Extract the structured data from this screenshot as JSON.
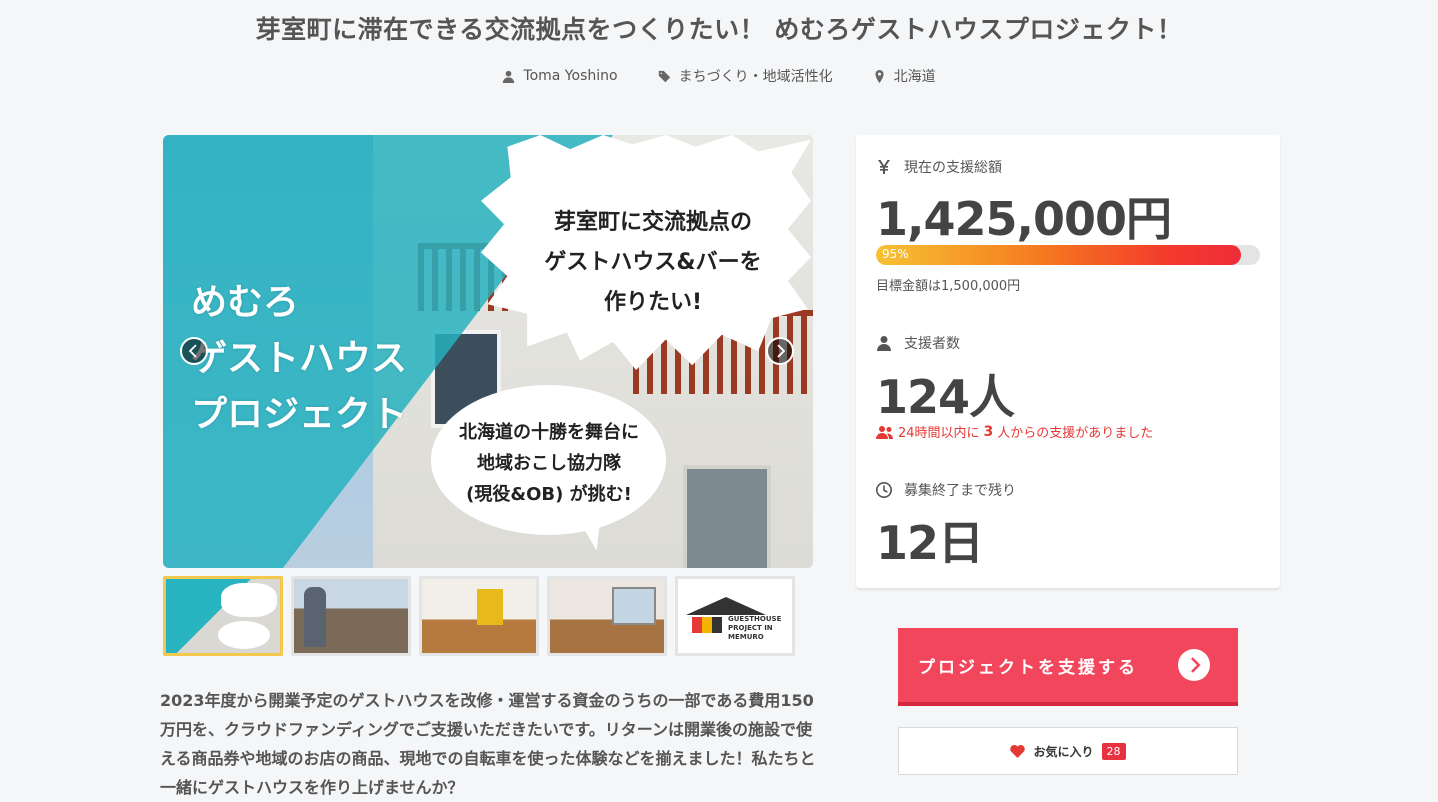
{
  "project": {
    "title": "芽室町に滞在できる交流拠点をつくりたい！ めむろゲストハウスプロジェクト！",
    "owner": "Toma Yoshino",
    "category": "まちづくり・地域活性化",
    "location": "北海道"
  },
  "hero": {
    "left_text": "めむろ\nゲストハウス\nプロジェクト",
    "burst_text": "芽室町に交流拠点の\nゲストハウス&バーを\n作りたい!",
    "bubble_text": "北海道の十勝を舞台に\n地域おこし協力隊\n(現役&OB) が挑む!",
    "thumbnails": [
      {
        "name": "thumb-1",
        "active": true
      },
      {
        "name": "thumb-2",
        "active": false
      },
      {
        "name": "thumb-3",
        "active": false
      },
      {
        "name": "thumb-4",
        "active": false
      },
      {
        "name": "thumb-5",
        "active": false,
        "label": "GUESTHOUSE PROJECT IN MEMURO"
      }
    ]
  },
  "description": "2023年度から開業予定のゲストハウスを改修・運営する資金のうちの一部である費用150万円を、クラウドファンディングでご支援いただきたいです。リターンは開業後の施設で使える商品券や地域のお店の商品、現地での自転車を使った体験などを揃えました！私たちと一緒にゲストハウスを作り上げませんか？",
  "stats": {
    "amount_label": "現在の支援総額",
    "amount": "1,425,000円",
    "progress_percent": 95,
    "progress_label": "95%",
    "goal_text": "目標金額は1,500,000円",
    "backers_label": "支援者数",
    "backers": "124人",
    "recent_prefix": "24時間以内に",
    "recent_count": "3",
    "recent_suffix": "人からの支援がありました",
    "remaining_label": "募集終了まで残り",
    "remaining": "12日"
  },
  "actions": {
    "support_label": "プロジェクトを支援する",
    "favorite_label": "お気に入り",
    "favorite_count": "28"
  },
  "colors": {
    "accent": "#f2465c",
    "progress_start": "#f6c233",
    "progress_end": "#ef2c3a",
    "alert": "#e53935"
  }
}
